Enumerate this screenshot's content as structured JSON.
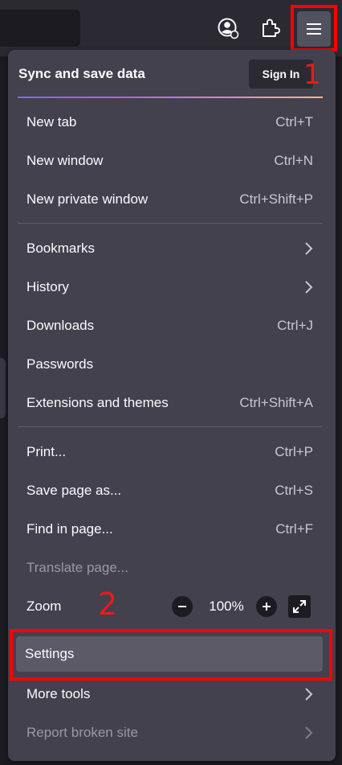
{
  "toolbar": {
    "account_icon": "account-icon",
    "extensions_icon": "puzzle-icon",
    "menu_icon": "hamburger-icon"
  },
  "menu": {
    "sync_label": "Sync and save data",
    "sign_in_label": "Sign In",
    "items": {
      "new_tab": {
        "label": "New tab",
        "shortcut": "Ctrl+T"
      },
      "new_window": {
        "label": "New window",
        "shortcut": "Ctrl+N"
      },
      "new_private_window": {
        "label": "New private window",
        "shortcut": "Ctrl+Shift+P"
      },
      "bookmarks": {
        "label": "Bookmarks"
      },
      "history": {
        "label": "History"
      },
      "downloads": {
        "label": "Downloads",
        "shortcut": "Ctrl+J"
      },
      "passwords": {
        "label": "Passwords"
      },
      "extensions": {
        "label": "Extensions and themes",
        "shortcut": "Ctrl+Shift+A"
      },
      "print": {
        "label": "Print...",
        "shortcut": "Ctrl+P"
      },
      "save_page": {
        "label": "Save page as...",
        "shortcut": "Ctrl+S"
      },
      "find": {
        "label": "Find in page...",
        "shortcut": "Ctrl+F"
      },
      "translate": {
        "label": "Translate page..."
      },
      "zoom": {
        "label": "Zoom",
        "value": "100%"
      },
      "settings": {
        "label": "Settings"
      },
      "more_tools": {
        "label": "More tools"
      },
      "report_broken": {
        "label": "Report broken site"
      }
    }
  },
  "annotations": {
    "step1": "1",
    "step2": "2",
    "highlight_color": "#ff0000",
    "number_color": "#e81b1b"
  },
  "colors": {
    "panel_bg": "#42414d",
    "toolbar_bg": "#2b2a33",
    "page_bg": "#1c1b22"
  }
}
